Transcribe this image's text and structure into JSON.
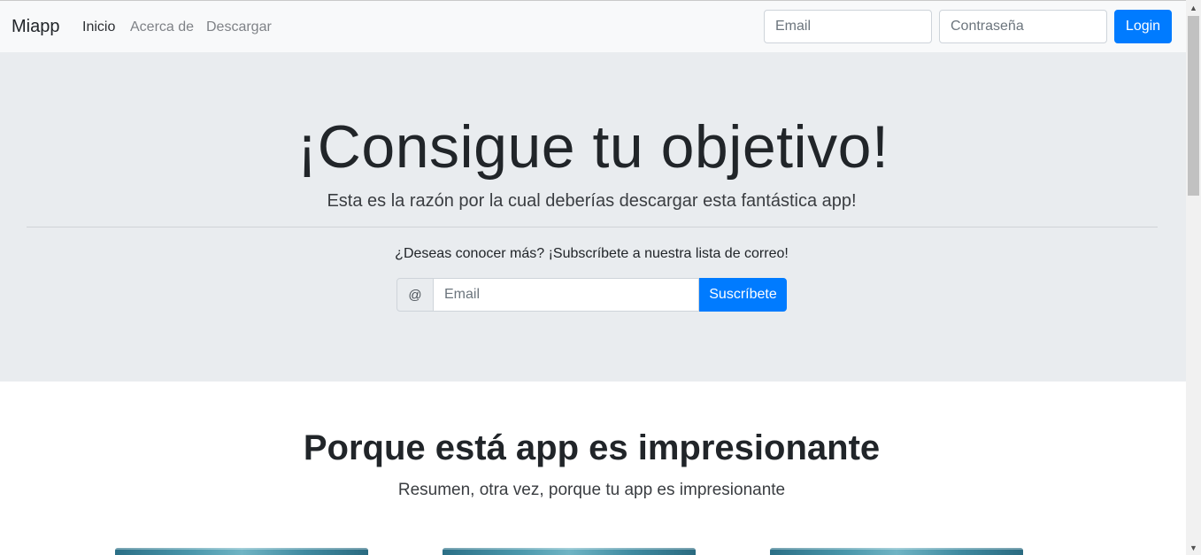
{
  "navbar": {
    "brand": "Miapp",
    "links": [
      "Inicio",
      "Acerca de",
      "Descargar"
    ],
    "email_placeholder": "Email",
    "password_placeholder": "Contraseña",
    "login_label": "Login"
  },
  "hero": {
    "title": "¡Consigue tu objetivo!",
    "lead": "Esta es la razón por la cual deberías descargar esta fantástica app!",
    "cta": "¿Deseas conocer más? ¡Subscríbete a nuestra lista de correo!",
    "at_symbol": "@",
    "email_placeholder": "Email",
    "subscribe_label": "Suscríbete"
  },
  "features": {
    "title": "Porque está app es impresionante",
    "lead": "Resumen, otra vez, porque tu app es impresionante"
  },
  "scrollbar": {
    "up_icon": "▲",
    "down_icon": "▼"
  },
  "colors": {
    "primary": "#007bff",
    "navbar_bg": "#f8f9fa",
    "jumbotron_bg": "#e9ecef"
  }
}
